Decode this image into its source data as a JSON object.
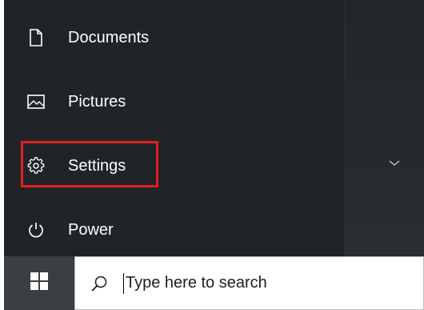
{
  "start_menu": {
    "items": [
      {
        "label": "Documents",
        "icon": "document-icon"
      },
      {
        "label": "Pictures",
        "icon": "pictures-icon"
      },
      {
        "label": "Settings",
        "icon": "gear-icon"
      },
      {
        "label": "Power",
        "icon": "power-icon"
      }
    ]
  },
  "taskbar": {
    "start_icon": "windows-logo-icon",
    "search": {
      "icon": "search-icon",
      "placeholder": "Type here to search"
    }
  },
  "colors": {
    "menu_background": "#202428",
    "highlight": "#e01e1e",
    "taskbar": "#3b3e42"
  }
}
